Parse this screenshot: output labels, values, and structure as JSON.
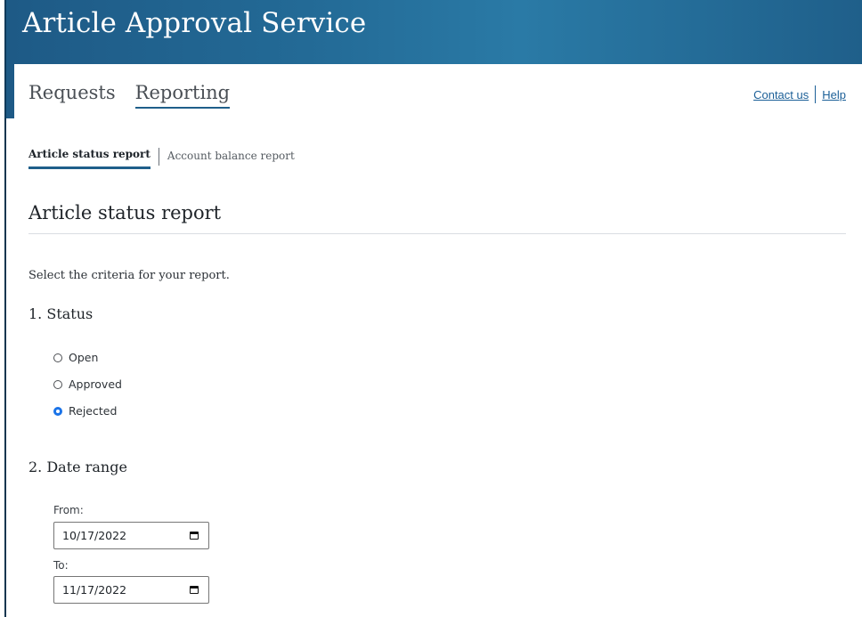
{
  "app": {
    "title": "Article Approval Service"
  },
  "nav": {
    "tabs": [
      {
        "label": "Requests",
        "active": false
      },
      {
        "label": "Reporting",
        "active": true
      }
    ],
    "links": {
      "contact": "Contact us",
      "help": "Help"
    }
  },
  "subnav": {
    "tabs": [
      {
        "label": "Article status report",
        "active": true
      },
      {
        "label": "Account balance report",
        "active": false
      }
    ]
  },
  "report": {
    "title": "Article status report",
    "intro": "Select the criteria for your report.",
    "status": {
      "heading": "1. Status",
      "options": [
        {
          "label": "Open",
          "checked": false
        },
        {
          "label": "Approved",
          "checked": false
        },
        {
          "label": "Rejected",
          "checked": true
        }
      ]
    },
    "date_range": {
      "heading": "2. Date range",
      "from": {
        "label": "From:",
        "value": "10/17/2022"
      },
      "to": {
        "label": "To:",
        "value": "11/17/2022"
      }
    }
  },
  "colors": {
    "banner": "#236a96",
    "accent": "#1f5f8a",
    "link": "#1b5f97",
    "radio_checked": "#1a73e8"
  },
  "icons": {
    "date_picker": "calendar-icon"
  }
}
